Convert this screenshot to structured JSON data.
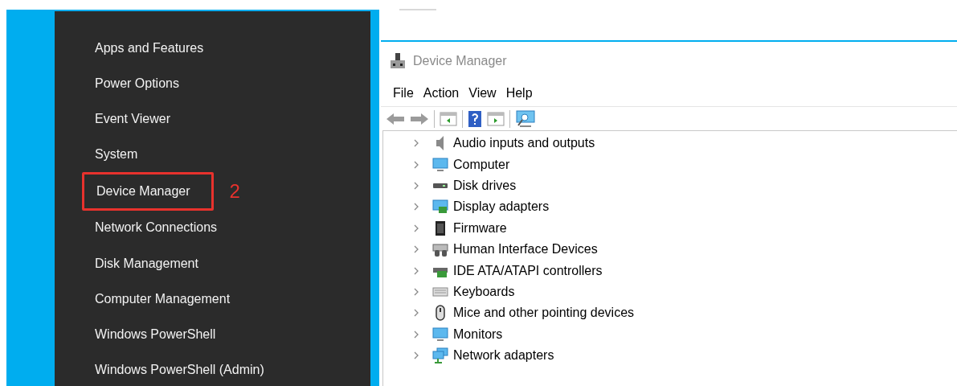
{
  "power_menu": {
    "items": [
      {
        "label": "Apps and Features",
        "highlighted": false
      },
      {
        "label": "Power Options",
        "highlighted": false
      },
      {
        "label": "Event Viewer",
        "highlighted": false
      },
      {
        "label": "System",
        "highlighted": false
      },
      {
        "label": "Device Manager",
        "highlighted": true
      },
      {
        "label": "Network Connections",
        "highlighted": false
      },
      {
        "label": "Disk Management",
        "highlighted": false
      },
      {
        "label": "Computer Management",
        "highlighted": false
      },
      {
        "label": "Windows PowerShell",
        "highlighted": false
      },
      {
        "label": "Windows PowerShell (Admin)",
        "highlighted": false
      }
    ]
  },
  "step_label": "2",
  "window": {
    "title": "Device Manager"
  },
  "menu_bar": [
    "File",
    "Action",
    "View",
    "Help"
  ],
  "tree": {
    "items": [
      {
        "label": "Audio inputs and outputs",
        "expanded": false
      },
      {
        "label": "Computer",
        "expanded": false
      },
      {
        "label": "Disk drives",
        "expanded": false
      },
      {
        "label": "Display adapters",
        "expanded": false
      },
      {
        "label": "Firmware",
        "expanded": false
      },
      {
        "label": "Human Interface Devices",
        "expanded": false
      },
      {
        "label": "IDE ATA/ATAPI controllers",
        "expanded": false
      },
      {
        "label": "Keyboards",
        "expanded": false
      },
      {
        "label": "Mice and other pointing devices",
        "expanded": false
      },
      {
        "label": "Monitors",
        "expanded": false
      },
      {
        "label": "Network adapters",
        "expanded": false
      }
    ]
  }
}
